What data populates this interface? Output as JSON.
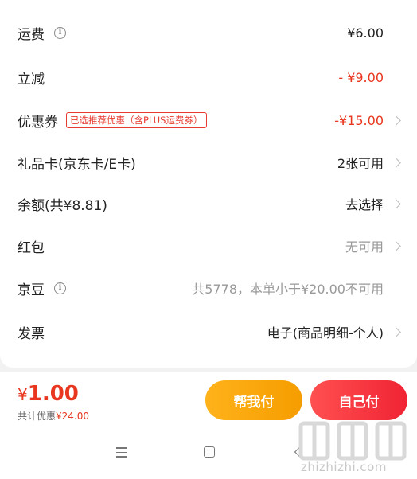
{
  "rows": [
    {
      "label": "运费",
      "value": "¥6.00"
    },
    {
      "label": "立减",
      "value": "- ¥9.00"
    },
    {
      "label": "优惠券",
      "tag": "已选推荐优惠（含PLUS运费券）",
      "value": "-¥15.00"
    },
    {
      "label": "礼品卡(京东卡/E卡)",
      "value": "2张可用"
    },
    {
      "label": "余额(共¥8.81)",
      "value": "去选择"
    },
    {
      "label": "红包",
      "value": "无可用"
    },
    {
      "label": "京豆",
      "value": "共5778，本单小于¥20.00不可用"
    },
    {
      "label": "发票",
      "value": "电子(商品明细-个人)"
    }
  ],
  "icons": {
    "info": "info-icon",
    "chevron": "chevron-right-icon"
  },
  "info_glyph": "i",
  "bottom": {
    "currency": "¥",
    "total": "1.00",
    "discount_label": "共计优惠",
    "discount_amount": "¥24.00",
    "help_pay": "帮我付",
    "self_pay": "自己付"
  },
  "nav": {
    "icons": [
      "menu-icon",
      "home-icon",
      "back-icon"
    ]
  },
  "watermark": {
    "text": "zhizhizhi.com"
  },
  "colors": {
    "accent_red": "#e8361f",
    "orange": "#f5a000",
    "gray_text": "#999999"
  }
}
